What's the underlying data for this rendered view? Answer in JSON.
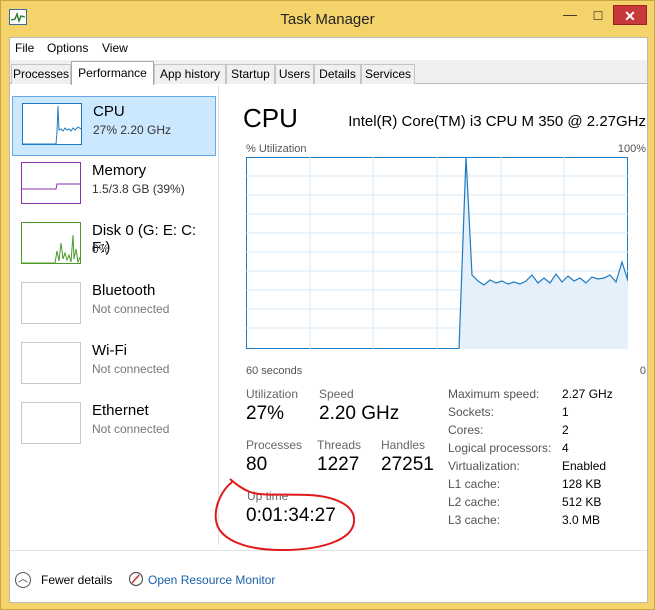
{
  "window": {
    "title": "Task Manager",
    "close_glyph": "✕",
    "min_glyph": "—",
    "max_glyph": "☐"
  },
  "menu": {
    "items": [
      "File",
      "Options",
      "View"
    ]
  },
  "tabs": [
    "Processes",
    "Performance",
    "App history",
    "Startup",
    "Users",
    "Details",
    "Services"
  ],
  "active_tab": "Performance",
  "sidebar": {
    "items": [
      {
        "name": "CPU",
        "sub": "27% 2.20 GHz",
        "color": "#1f7bc1"
      },
      {
        "name": "Memory",
        "sub": "1.5/3.8 GB (39%)",
        "color": "#8b32a8"
      },
      {
        "name": "Disk 0 (G: E: C: F:)",
        "sub": "0%",
        "color": "#4c9a2a"
      },
      {
        "name": "Bluetooth",
        "sub": "Not connected"
      },
      {
        "name": "Wi-Fi",
        "sub": "Not connected"
      },
      {
        "name": "Ethernet",
        "sub": "Not connected"
      }
    ]
  },
  "cpu": {
    "title": "CPU",
    "model": "Intel(R) Core(TM) i3 CPU M 350 @ 2.27GHz",
    "graph": {
      "top_left": "% Utilization",
      "top_right": "100%",
      "bottom_left": "60 seconds",
      "bottom_right": "0",
      "line_color": "#1f7bc1",
      "grid_color": "#d9eaf7"
    },
    "stats": {
      "utilization_label": "Utilization",
      "utilization": "27%",
      "speed_label": "Speed",
      "speed": "2.20 GHz",
      "processes_label": "Processes",
      "processes": "80",
      "threads_label": "Threads",
      "threads": "1227",
      "handles_label": "Handles",
      "handles": "27251",
      "uptime_label": "Up time",
      "uptime": "0:01:34:27"
    },
    "properties": [
      {
        "key": "Maximum speed:",
        "value": "2.27 GHz"
      },
      {
        "key": "Sockets:",
        "value": "1"
      },
      {
        "key": "Cores:",
        "value": "2"
      },
      {
        "key": "Logical processors:",
        "value": "4"
      },
      {
        "key": "Virtualization:",
        "value": "Enabled"
      },
      {
        "key": "L1 cache:",
        "value": "128 KB"
      },
      {
        "key": "L2 cache:",
        "value": "512 KB"
      },
      {
        "key": "L3 cache:",
        "value": "3.0 MB"
      }
    ]
  },
  "footer": {
    "fewer_details": "Fewer details",
    "resource_monitor": "Open Resource Monitor"
  },
  "annotation_color": "#e0191c"
}
